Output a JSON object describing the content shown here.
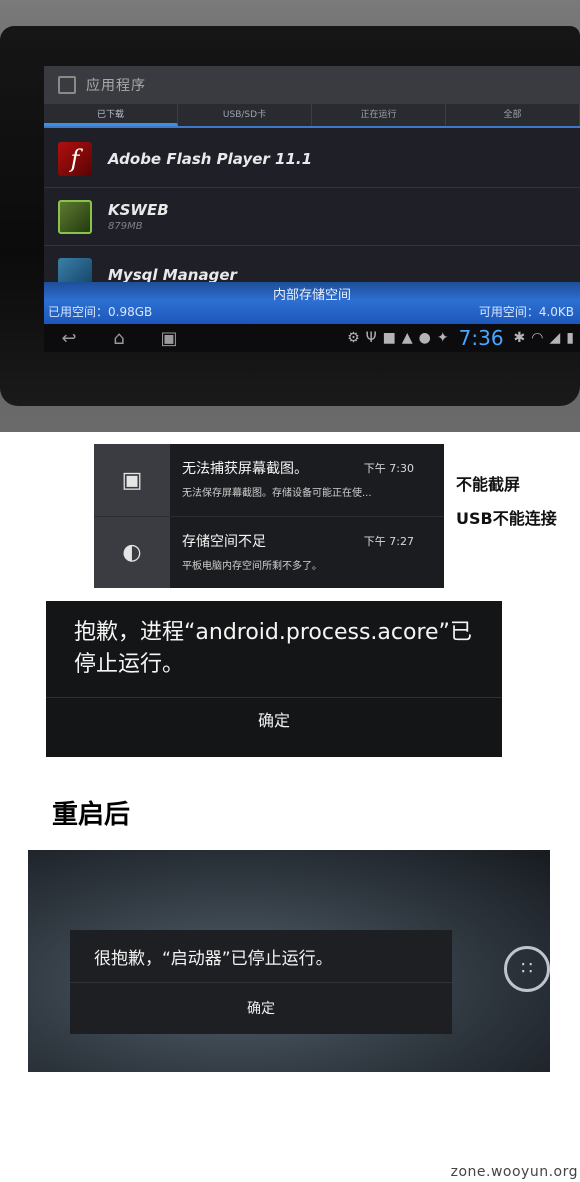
{
  "tablet": {
    "app_title": "应用程序",
    "tabs": [
      "已下载",
      "USB/SD卡",
      "正在运行",
      "全部"
    ],
    "apps": [
      {
        "name": "Adobe Flash Player 11.1",
        "size": "",
        "icon": "flash-icon"
      },
      {
        "name": "KSWEB",
        "size": "879MB",
        "icon": "ksweb-icon"
      },
      {
        "name": "Mysql Manager",
        "size": "",
        "icon": "mysql-icon"
      }
    ],
    "storage": {
      "title": "内部存储空间",
      "used": "已用空间：0.98GB",
      "free": "可用空间：4.0KB"
    },
    "clock": "7:36"
  },
  "notifications": [
    {
      "title": "无法捕获屏幕截图。",
      "text": "无法保存屏幕截图。存储设备可能正在使...",
      "time": "下午 7:30",
      "icon": "picture-warning-icon"
    },
    {
      "title": "存储空间不足",
      "text": "平板电脑内存空间所剩不多了。",
      "time": "下午 7:27",
      "icon": "storage-warning-icon"
    }
  ],
  "side_notes": [
    "不能截屏",
    "USB不能连接"
  ],
  "dialog1": {
    "message": "抱歉，进程“android.process.acore”已停止运行。",
    "button": "确定"
  },
  "section_title": "重启后",
  "dialog2": {
    "message": "很抱歉，“启动器”已停止运行。",
    "button": "确定"
  },
  "watermark": "zone.wooyun.org"
}
